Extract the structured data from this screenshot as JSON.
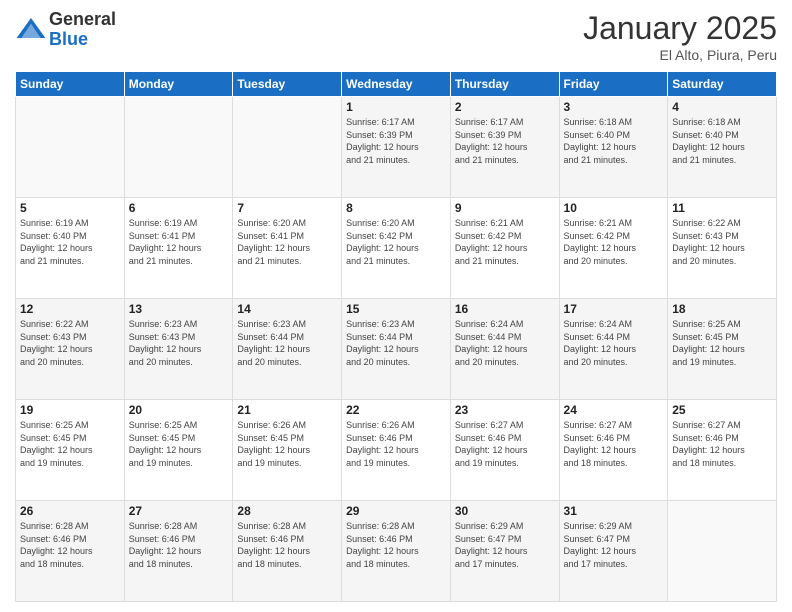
{
  "logo": {
    "general": "General",
    "blue": "Blue"
  },
  "header": {
    "month": "January 2025",
    "location": "El Alto, Piura, Peru"
  },
  "days_of_week": [
    "Sunday",
    "Monday",
    "Tuesday",
    "Wednesday",
    "Thursday",
    "Friday",
    "Saturday"
  ],
  "weeks": [
    [
      {
        "day": "",
        "info": ""
      },
      {
        "day": "",
        "info": ""
      },
      {
        "day": "",
        "info": ""
      },
      {
        "day": "1",
        "info": "Sunrise: 6:17 AM\nSunset: 6:39 PM\nDaylight: 12 hours\nand 21 minutes."
      },
      {
        "day": "2",
        "info": "Sunrise: 6:17 AM\nSunset: 6:39 PM\nDaylight: 12 hours\nand 21 minutes."
      },
      {
        "day": "3",
        "info": "Sunrise: 6:18 AM\nSunset: 6:40 PM\nDaylight: 12 hours\nand 21 minutes."
      },
      {
        "day": "4",
        "info": "Sunrise: 6:18 AM\nSunset: 6:40 PM\nDaylight: 12 hours\nand 21 minutes."
      }
    ],
    [
      {
        "day": "5",
        "info": "Sunrise: 6:19 AM\nSunset: 6:40 PM\nDaylight: 12 hours\nand 21 minutes."
      },
      {
        "day": "6",
        "info": "Sunrise: 6:19 AM\nSunset: 6:41 PM\nDaylight: 12 hours\nand 21 minutes."
      },
      {
        "day": "7",
        "info": "Sunrise: 6:20 AM\nSunset: 6:41 PM\nDaylight: 12 hours\nand 21 minutes."
      },
      {
        "day": "8",
        "info": "Sunrise: 6:20 AM\nSunset: 6:42 PM\nDaylight: 12 hours\nand 21 minutes."
      },
      {
        "day": "9",
        "info": "Sunrise: 6:21 AM\nSunset: 6:42 PM\nDaylight: 12 hours\nand 21 minutes."
      },
      {
        "day": "10",
        "info": "Sunrise: 6:21 AM\nSunset: 6:42 PM\nDaylight: 12 hours\nand 20 minutes."
      },
      {
        "day": "11",
        "info": "Sunrise: 6:22 AM\nSunset: 6:43 PM\nDaylight: 12 hours\nand 20 minutes."
      }
    ],
    [
      {
        "day": "12",
        "info": "Sunrise: 6:22 AM\nSunset: 6:43 PM\nDaylight: 12 hours\nand 20 minutes."
      },
      {
        "day": "13",
        "info": "Sunrise: 6:23 AM\nSunset: 6:43 PM\nDaylight: 12 hours\nand 20 minutes."
      },
      {
        "day": "14",
        "info": "Sunrise: 6:23 AM\nSunset: 6:44 PM\nDaylight: 12 hours\nand 20 minutes."
      },
      {
        "day": "15",
        "info": "Sunrise: 6:23 AM\nSunset: 6:44 PM\nDaylight: 12 hours\nand 20 minutes."
      },
      {
        "day": "16",
        "info": "Sunrise: 6:24 AM\nSunset: 6:44 PM\nDaylight: 12 hours\nand 20 minutes."
      },
      {
        "day": "17",
        "info": "Sunrise: 6:24 AM\nSunset: 6:44 PM\nDaylight: 12 hours\nand 20 minutes."
      },
      {
        "day": "18",
        "info": "Sunrise: 6:25 AM\nSunset: 6:45 PM\nDaylight: 12 hours\nand 19 minutes."
      }
    ],
    [
      {
        "day": "19",
        "info": "Sunrise: 6:25 AM\nSunset: 6:45 PM\nDaylight: 12 hours\nand 19 minutes."
      },
      {
        "day": "20",
        "info": "Sunrise: 6:25 AM\nSunset: 6:45 PM\nDaylight: 12 hours\nand 19 minutes."
      },
      {
        "day": "21",
        "info": "Sunrise: 6:26 AM\nSunset: 6:45 PM\nDaylight: 12 hours\nand 19 minutes."
      },
      {
        "day": "22",
        "info": "Sunrise: 6:26 AM\nSunset: 6:46 PM\nDaylight: 12 hours\nand 19 minutes."
      },
      {
        "day": "23",
        "info": "Sunrise: 6:27 AM\nSunset: 6:46 PM\nDaylight: 12 hours\nand 19 minutes."
      },
      {
        "day": "24",
        "info": "Sunrise: 6:27 AM\nSunset: 6:46 PM\nDaylight: 12 hours\nand 18 minutes."
      },
      {
        "day": "25",
        "info": "Sunrise: 6:27 AM\nSunset: 6:46 PM\nDaylight: 12 hours\nand 18 minutes."
      }
    ],
    [
      {
        "day": "26",
        "info": "Sunrise: 6:28 AM\nSunset: 6:46 PM\nDaylight: 12 hours\nand 18 minutes."
      },
      {
        "day": "27",
        "info": "Sunrise: 6:28 AM\nSunset: 6:46 PM\nDaylight: 12 hours\nand 18 minutes."
      },
      {
        "day": "28",
        "info": "Sunrise: 6:28 AM\nSunset: 6:46 PM\nDaylight: 12 hours\nand 18 minutes."
      },
      {
        "day": "29",
        "info": "Sunrise: 6:28 AM\nSunset: 6:46 PM\nDaylight: 12 hours\nand 18 minutes."
      },
      {
        "day": "30",
        "info": "Sunrise: 6:29 AM\nSunset: 6:47 PM\nDaylight: 12 hours\nand 17 minutes."
      },
      {
        "day": "31",
        "info": "Sunrise: 6:29 AM\nSunset: 6:47 PM\nDaylight: 12 hours\nand 17 minutes."
      },
      {
        "day": "",
        "info": ""
      }
    ]
  ]
}
